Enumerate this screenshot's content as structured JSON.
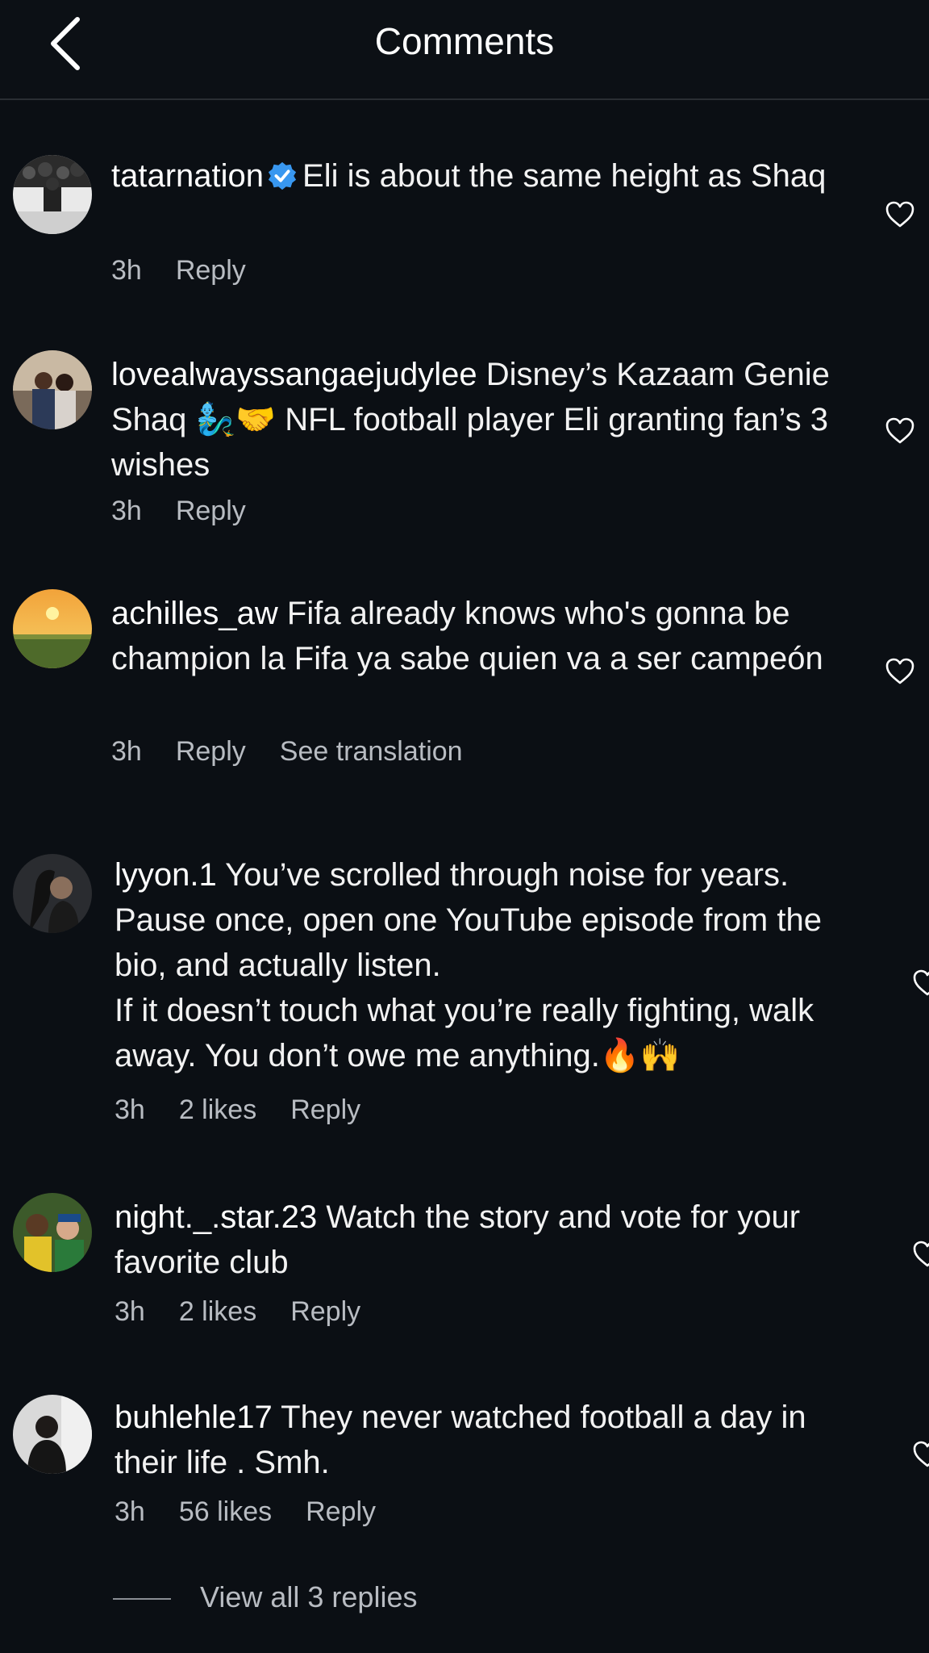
{
  "header": {
    "title": "Comments",
    "back_icon": "chevron-left-icon"
  },
  "comments": [
    {
      "username": "tatarnation",
      "verified": true,
      "text": "Eli is about the same height as Shaq",
      "time": "3h",
      "likes": "",
      "reply": "Reply",
      "translation": ""
    },
    {
      "username": "lovealwayssangaejudylee",
      "verified": false,
      "text_before": "Disney’s Kazaam Genie Shaq",
      "emojis": "🧞‍♂️🤝",
      "text_after": "NFL football player Eli granting fan’s 3 wishes",
      "time": "3h",
      "likes": "",
      "reply": "Reply",
      "translation": ""
    },
    {
      "username": "achilles_aw",
      "verified": false,
      "text": "Fifa already knows who's gonna be champion la Fifa ya sabe quien va a ser campeón",
      "time": "3h",
      "likes": "",
      "reply": "Reply",
      "translation": "See translation"
    },
    {
      "username": "lyyon.1",
      "verified": false,
      "text_line1": "You’ve scrolled through noise for years. Pause once, open one YouTube episode from the bio, and actually listen.",
      "text_line2": "If it doesn’t touch what you’re really fighting, walk away. You don’t owe me anything.",
      "emojis": "🔥🙌",
      "time": "3h",
      "likes": "2 likes",
      "reply": "Reply",
      "translation": ""
    },
    {
      "username": "night._.star.23",
      "verified": false,
      "text": "Watch the story and vote for your favorite club",
      "time": "3h",
      "likes": "2 likes",
      "reply": "Reply",
      "translation": ""
    },
    {
      "username": "buhlehle17",
      "verified": false,
      "text": "They never watched football a day in their life . Smh.",
      "time": "3h",
      "likes": "56 likes",
      "reply": "Reply",
      "translation": ""
    }
  ],
  "view_replies": "View all 3 replies",
  "colors": {
    "background": "#0b0f14",
    "text": "#f2f2f2",
    "meta": "#b8bcc2",
    "verified": "#3897f0"
  },
  "icons": {
    "like": "heart-outline-icon",
    "verified": "verified-badge-icon"
  }
}
